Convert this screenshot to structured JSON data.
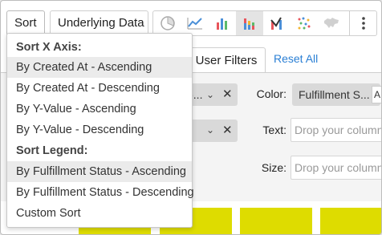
{
  "toolbar": {
    "sort_label": "Sort",
    "underlying_label": "Underlying Data",
    "chart_types": [
      "pie-chart-icon",
      "line-chart-icon",
      "bar-chart-icon",
      "stacked-bar-chart-icon",
      "combo-chart-icon",
      "scatter-chart-icon",
      "map-chart-icon"
    ],
    "active_chart_type": "stacked-bar-chart-icon",
    "more_icon": "more-vertical-icon"
  },
  "filters": {
    "user_filters_tab": "User Filters",
    "reset_all": "Reset All"
  },
  "encoding": {
    "pill1_text": "e...",
    "color_label": "Color:",
    "color_value": "Fulfillment S...",
    "color_extra": "A",
    "text_label": "Text:",
    "text_placeholder": "Drop your column",
    "size_label": "Size:",
    "size_placeholder": "Drop your column"
  },
  "sort_menu": {
    "x_axis_header": "Sort X Axis:",
    "items_x": [
      "By Created At - Ascending",
      "By Created At - Descending",
      "By Y-Value - Ascending",
      "By Y-Value - Descending"
    ],
    "legend_header": "Sort Legend:",
    "items_legend": [
      "By Fulfillment Status - Ascending",
      "By Fulfillment Status - Descending"
    ],
    "custom": "Custom Sort",
    "selected_x_index": 0,
    "selected_legend_index": 0
  },
  "colors": {
    "accent": "#2a7fd4",
    "bar": "#dedc00",
    "selected": "#ebebeb"
  }
}
